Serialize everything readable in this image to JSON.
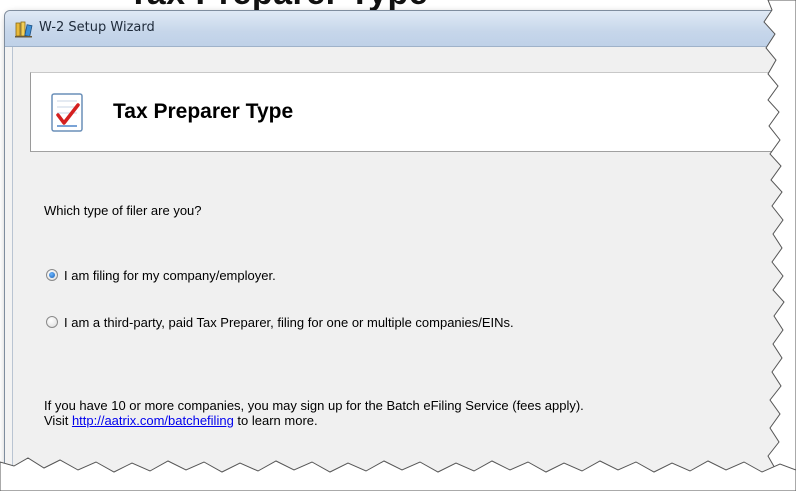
{
  "page": {
    "heading": "Tax Preparer Type"
  },
  "window": {
    "title": "W-2 Setup Wizard",
    "app_icon": "books-icon"
  },
  "header": {
    "icon": "checklist-icon",
    "title": "Tax Preparer Type"
  },
  "form": {
    "question": "Which type of filer are you?",
    "options": [
      {
        "label": "I am filing for my company/employer.",
        "selected": true
      },
      {
        "label": "I am a third-party, paid Tax Preparer, filing for one or multiple companies/EINs.",
        "selected": false
      }
    ]
  },
  "info": {
    "line1": "If you have 10 or more companies, you may sign up for the Batch eFiling Service (fees apply).",
    "visit_prefix": "Visit ",
    "link_text": "http://aatrix.com/batchefiling",
    "visit_suffix": " to learn more."
  },
  "colors": {
    "link": "#0000ee",
    "titlebar": "#c6d6ea",
    "radio_selected": "#1a5fb4"
  }
}
